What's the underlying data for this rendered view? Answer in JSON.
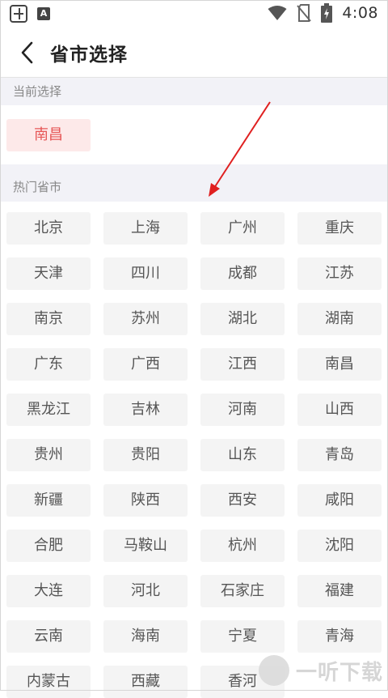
{
  "status_bar": {
    "time": "4:08",
    "icons": [
      "app-icon",
      "a-icon",
      "wifi-icon",
      "no-sim-icon",
      "battery-charging-icon"
    ]
  },
  "header": {
    "title": "省市选择",
    "back_icon": "chevron-left-icon"
  },
  "current": {
    "label": "当前选择",
    "selected": "南昌",
    "accent_color": "#e65757",
    "accent_bg": "#fde9e9"
  },
  "hot": {
    "label": "热门省市",
    "cities": [
      "北京",
      "上海",
      "广州",
      "重庆",
      "天津",
      "四川",
      "成都",
      "江苏",
      "南京",
      "苏州",
      "湖北",
      "湖南",
      "广东",
      "广西",
      "江西",
      "南昌",
      "黑龙江",
      "吉林",
      "河南",
      "山西",
      "贵州",
      "贵阳",
      "山东",
      "青岛",
      "新疆",
      "陕西",
      "西安",
      "咸阳",
      "合肥",
      "马鞍山",
      "杭州",
      "沈阳",
      "大连",
      "河北",
      "石家庄",
      "福建",
      "云南",
      "海南",
      "宁夏",
      "青海",
      "内蒙古",
      "西藏",
      "香河"
    ]
  },
  "annotation": {
    "arrow_color": "#e02020"
  },
  "watermark": {
    "text": "一听下载",
    "icon_text": "听"
  }
}
